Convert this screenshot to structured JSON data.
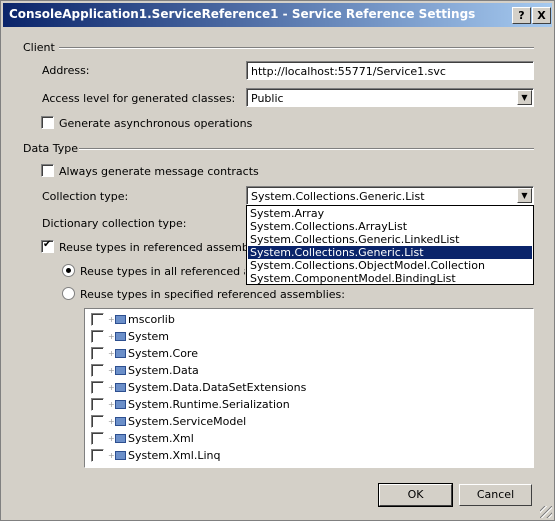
{
  "window": {
    "title": "ConsoleApplication1.ServiceReference1 - Service Reference Settings",
    "help_glyph": "?",
    "close_glyph": "X"
  },
  "client": {
    "group_label": "Client",
    "address_label": "Address:",
    "address_value": "http://localhost:55771/Service1.svc",
    "access_label": "Access level for generated classes:",
    "access_value": "Public",
    "async_label": "Generate asynchronous operations",
    "async_checked": false
  },
  "data_type": {
    "group_label": "Data Type",
    "msg_contracts_label": "Always generate message contracts",
    "msg_contracts_checked": false,
    "collection_label": "Collection type:",
    "collection_value": "System.Collections.Generic.List",
    "collection_options": [
      "System.Array",
      "System.Collections.ArrayList",
      "System.Collections.Generic.LinkedList",
      "System.Collections.Generic.List",
      "System.Collections.ObjectModel.Collection",
      "System.ComponentModel.BindingList"
    ],
    "collection_selected_index": 3,
    "dictionary_label": "Dictionary collection type:",
    "reuse_label": "Reuse types in referenced assemblies",
    "reuse_checked": true,
    "reuse_all_label": "Reuse types in all referenced asse",
    "reuse_specified_label": "Reuse types in specified referenced assemblies:",
    "assemblies": [
      "mscorlib",
      "System",
      "System.Core",
      "System.Data",
      "System.Data.DataSetExtensions",
      "System.Runtime.Serialization",
      "System.ServiceModel",
      "System.Xml",
      "System.Xml.Linq"
    ]
  },
  "buttons": {
    "ok": "OK",
    "cancel": "Cancel"
  },
  "icons": {
    "dropdown": "triangle-down-icon",
    "assembly": "assembly-icon"
  }
}
